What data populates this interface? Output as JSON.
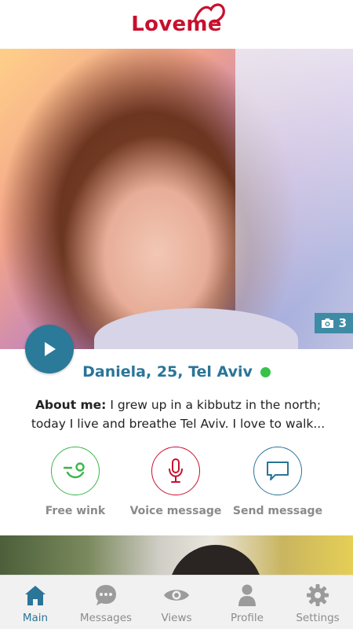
{
  "header": {
    "logo_text": "Loveme"
  },
  "profile": {
    "photo_count": "3",
    "name_line": "Daniela, 25, Tel Aviv",
    "online": true,
    "about_label": "About me:",
    "about_text": "I grew up in a kibbutz in the north; today I live and breathe Tel Aviv. I love to walk..."
  },
  "actions": [
    {
      "label": "Free wink",
      "icon": "wink-icon",
      "color": "#3bb54a"
    },
    {
      "label": "Voice message",
      "icon": "microphone-icon",
      "color": "#c8102e"
    },
    {
      "label": "Send message",
      "icon": "chat-bubble-icon",
      "color": "#2a7598"
    }
  ],
  "nav": {
    "items": [
      {
        "label": "Main",
        "icon": "home-icon",
        "active": true
      },
      {
        "label": "Messages",
        "icon": "messages-icon",
        "active": false
      },
      {
        "label": "Views",
        "icon": "eye-icon",
        "active": false
      },
      {
        "label": "Profile",
        "icon": "person-icon",
        "active": false
      },
      {
        "label": "Settings",
        "icon": "gear-icon",
        "active": false
      }
    ]
  },
  "colors": {
    "brand_red": "#c8102e",
    "accent_blue": "#2a7598",
    "online_green": "#38c24a",
    "inactive_gray": "#8c8c8c"
  }
}
